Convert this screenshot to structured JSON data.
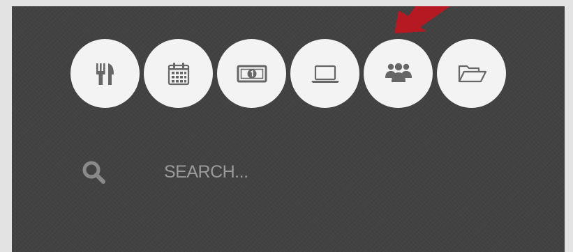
{
  "toolbar": {
    "icons": [
      {
        "name": "restaurant-icon"
      },
      {
        "name": "calendar-icon"
      },
      {
        "name": "money-icon"
      },
      {
        "name": "laptop-icon"
      },
      {
        "name": "users-icon"
      },
      {
        "name": "folder-open-icon"
      }
    ]
  },
  "search": {
    "icon": "search-icon",
    "placeholder": "SEARCH..."
  },
  "colors": {
    "panel": "#424242",
    "circle": "#f3f3f3",
    "icon": "#666666",
    "accent_arrow": "#b51a22",
    "search_text": "#9a9a9a"
  }
}
